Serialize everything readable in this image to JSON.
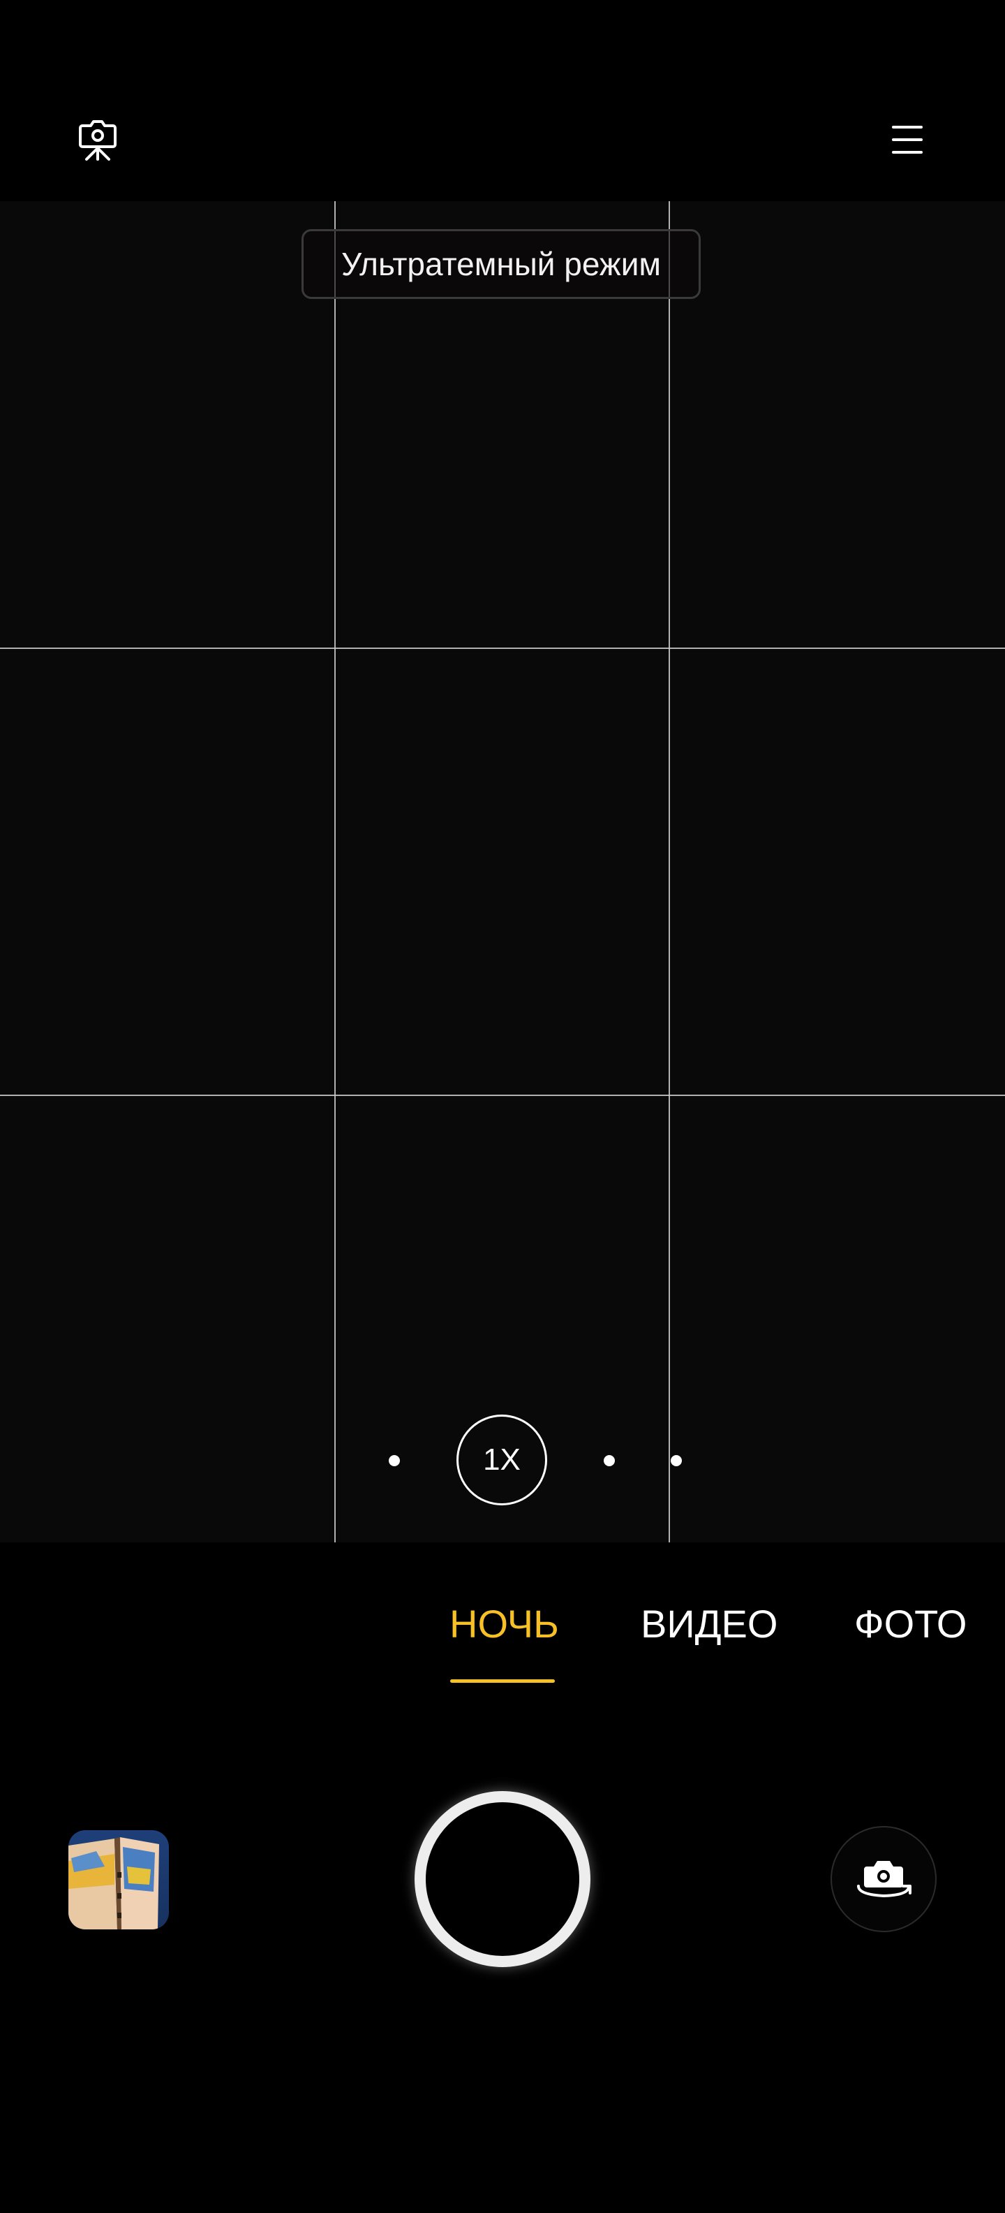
{
  "top_bar": {
    "camera_settings_icon": "camera-settings-icon",
    "menu_icon": "hamburger-menu-icon"
  },
  "viewfinder": {
    "mode_hint": "Ультратемный режим",
    "zoom_label": "1X"
  },
  "modes": {
    "night": "НОЧЬ",
    "video": "ВИДЕО",
    "photo": "ФОТО",
    "active": "night"
  },
  "colors": {
    "accent": "#f6c026",
    "background": "#000000",
    "viewfinder": "#0a0909"
  },
  "controls": {
    "gallery_icon": "gallery-thumbnail",
    "shutter_icon": "shutter-button",
    "switch_icon": "switch-camera-icon"
  }
}
